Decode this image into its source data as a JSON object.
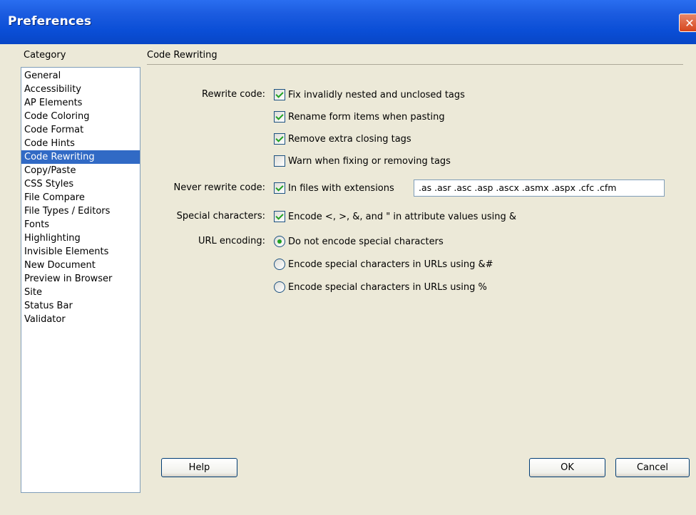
{
  "window": {
    "title": "Preferences"
  },
  "category": {
    "label": "Category",
    "items": [
      "General",
      "Accessibility",
      "AP Elements",
      "Code Coloring",
      "Code Format",
      "Code Hints",
      "Code Rewriting",
      "Copy/Paste",
      "CSS Styles",
      "File Compare",
      "File Types / Editors",
      "Fonts",
      "Highlighting",
      "Invisible Elements",
      "New Document",
      "Preview in Browser",
      "Site",
      "Status Bar",
      "Validator"
    ],
    "selected": "Code Rewriting"
  },
  "section": {
    "title": "Code Rewriting"
  },
  "rewrite": {
    "label": "Rewrite code:",
    "options": [
      {
        "label": "Fix invalidly nested and unclosed tags",
        "checked": true
      },
      {
        "label": "Rename form items when pasting",
        "checked": true
      },
      {
        "label": "Remove extra closing tags",
        "checked": true
      },
      {
        "label": "Warn when fixing or removing tags",
        "checked": false
      }
    ]
  },
  "never_rewrite": {
    "label": "Never rewrite code:",
    "option": {
      "label": "In files with extensions",
      "checked": true
    },
    "extensions_value": ".as .asr .asc .asp .ascx .asmx .aspx .cfc .cfm"
  },
  "special_chars": {
    "label": "Special characters:",
    "option": {
      "label": "Encode <, >, &, and \" in attribute values using &",
      "checked": true
    }
  },
  "url_encoding": {
    "label": "URL encoding:",
    "options": [
      {
        "label": "Do not encode special characters",
        "checked": true
      },
      {
        "label": "Encode special characters in URLs using &#",
        "checked": false
      },
      {
        "label": "Encode special characters in URLs using %",
        "checked": false
      }
    ]
  },
  "buttons": {
    "help": "Help",
    "ok": "OK",
    "cancel": "Cancel"
  },
  "colors": {
    "title_bar": "#0A4ED6",
    "selection": "#316AC5",
    "dialog_bg": "#ECE9D8",
    "check": "#21A121"
  }
}
